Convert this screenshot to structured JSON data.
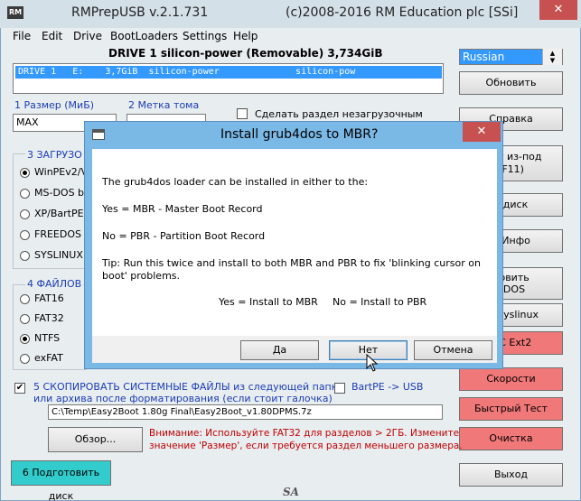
{
  "window": {
    "title_app": "RMPrepUSB v.2.1.731",
    "title_copyright": "(c)2008-2016 RM Education plc [SSi]",
    "app_icon_text": "RM",
    "close_glyph": "✕"
  },
  "menu": [
    "File",
    "Edit",
    "Drive",
    "BootLoaders",
    "Settings",
    "Help"
  ],
  "drive": {
    "header": "DRIVE 1  silicon-power  (Removable) 3,734GiB",
    "row": "DRIVE 1   E:    3,7GiB  silicon-power              silicon-pow"
  },
  "language": {
    "selected": "Russian",
    "arrow_up": "▲",
    "arrow_down": "▼"
  },
  "right_buttons": {
    "refresh": "Обновить",
    "help": "Справка",
    "run_from": "Тест из-под",
    "run_from_key": "(F11)",
    "disk": "ь диск",
    "mbr_info": "R Инфо",
    "grub4dos_top": "новить",
    "grub4dos_bot": "4DOS",
    "syslinux": "ть syslinux",
    "ext2": "ФС Ext2",
    "speed": "Скорости",
    "quick_test": "Быстрый Тест",
    "clean": "Очистка",
    "exit": "Выход"
  },
  "size": {
    "label": "1 Размер (МиБ)",
    "value": "MAX"
  },
  "volume": {
    "label": "2 Метка тома"
  },
  "nonboot": {
    "label": "Сделать раздел незагрузочным"
  },
  "boot_group": {
    "label": "3 ЗАГРУЗО",
    "options": [
      "WinPEv2/V",
      "MS-DOS bo",
      "XP/BartPE",
      "FREEDOS",
      "SYSLINUX"
    ]
  },
  "fs_group": {
    "label": "4 ФАЙЛОВ",
    "options": [
      "FAT16",
      "FAT32",
      "NTFS",
      "exFAT"
    ]
  },
  "copy": {
    "check_glyph": "✔",
    "label_line1": "5 СКОПИРОВАТЬ СИСТЕМНЫЕ ФАЙЛЫ из следующей папки",
    "label_line2": "или архива после форматирования (если стоит галочка)",
    "bartpe": "BartPE -> USB",
    "path": "C:\\Temp\\Easy2Boot 1.80g Final\\Easy2Boot_v1.80DPMS.7z",
    "browse": "Обзор...",
    "warning_line1": "Внимание: Используйте FAT32 для разделов > 2ГБ. Измените",
    "warning_line2": "значение 'Размер', если требуется раздел меньшего размера."
  },
  "prepare": {
    "label": "6 Подготовить диск"
  },
  "dialog": {
    "title": "Install grub4dos to MBR?",
    "line1": "The grub4dos loader can be installed in either to the:",
    "line2": "Yes = MBR - Master Boot Record",
    "line3": "No = PBR - Partition Boot Record",
    "tip1": "Tip: Run this twice and install to both MBR and PBR to fix 'blinking cursor on",
    "tip2": "boot' problems.",
    "summary_yes": "Yes = Install to MBR",
    "summary_no": "No = Install to PBR",
    "btn_yes": "Да",
    "btn_no": "Нет",
    "btn_cancel": "Отмена"
  },
  "footer": {
    "logo": "SA"
  }
}
